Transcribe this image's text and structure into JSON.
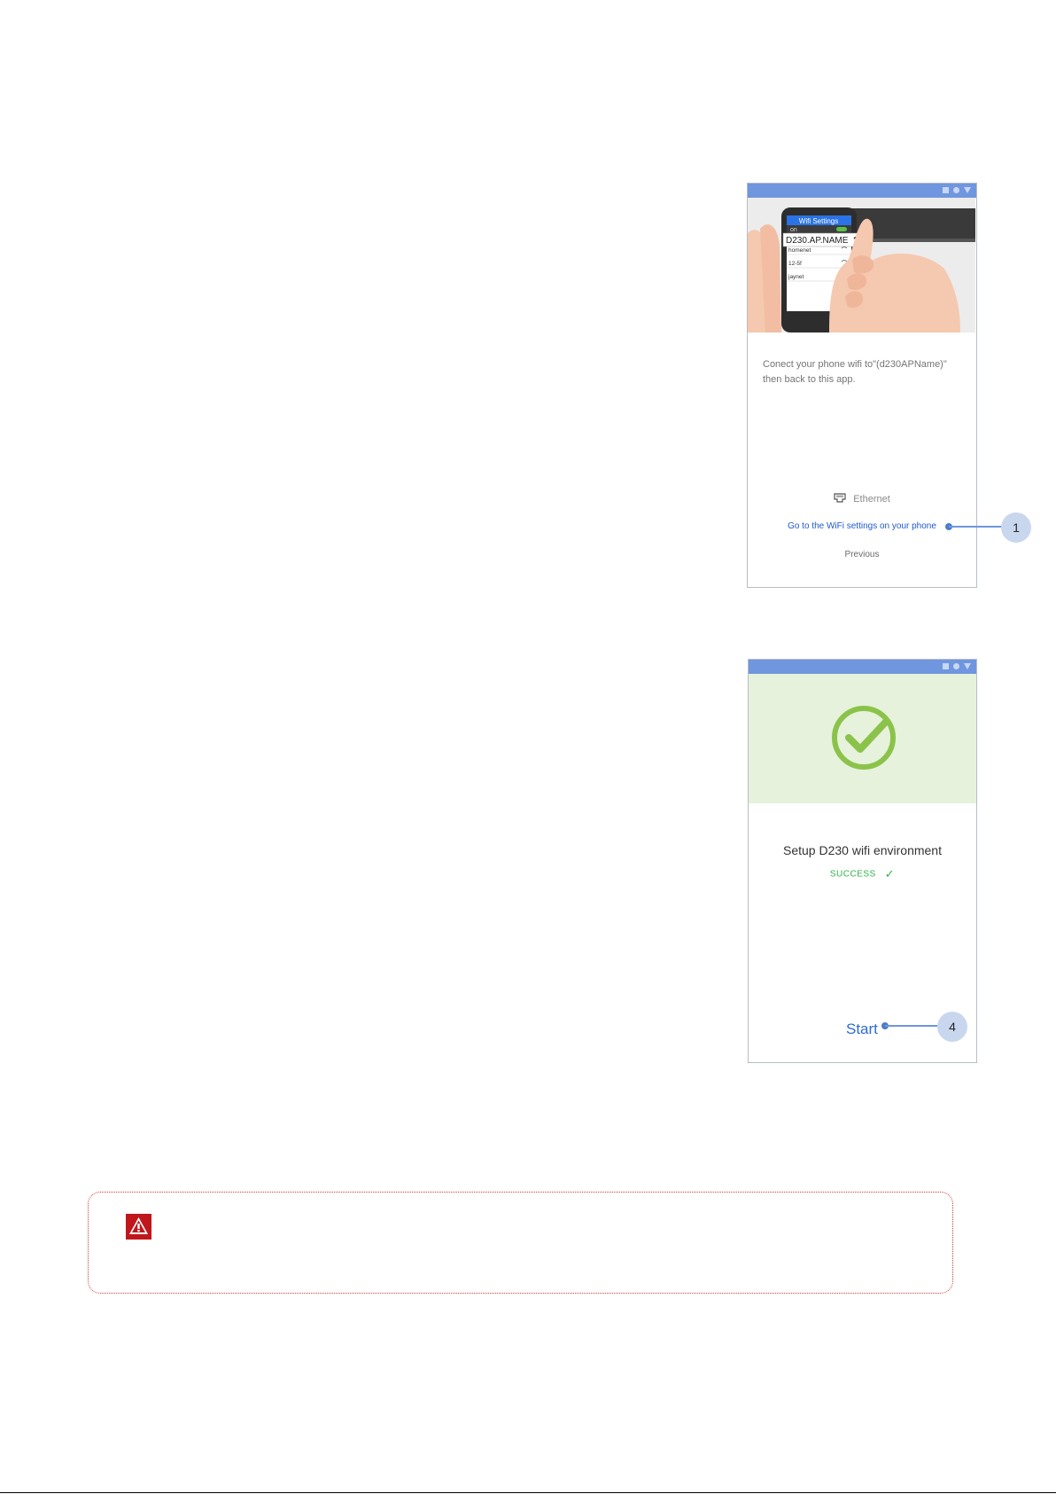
{
  "phone1": {
    "illustration": {
      "wifi_settings_label": "Wifi Settings",
      "on_label": "on",
      "selected_network": "D230.AP.NAME",
      "networks": [
        "homenet",
        "12-5f",
        "jaynet"
      ]
    },
    "instruction_text": "Conect your phone wifi to\"(d230APName)\" then back to this app.",
    "ethernet_label": "Ethernet",
    "goto_wifi_link": "Go to the WiFi settings on your phone",
    "previous_label": "Previous",
    "callout_number": "1"
  },
  "phone2": {
    "setup_title": "Setup D230 wifi environment",
    "success_label": "SUCCESS",
    "success_tick": "✓",
    "start_label": "Start",
    "callout_number": "4"
  },
  "colors": {
    "status_bar": "#6f96de",
    "link_blue": "#1f5ad1",
    "success_green": "#2fb34a",
    "check_green": "#8bc34a",
    "warning_red": "#c0171c",
    "callout_bubble": "#c9d7ee"
  },
  "icons": {
    "warning": "warning-triangle-icon",
    "ethernet": "ethernet-port-icon",
    "check": "check-circle-icon",
    "wifi": "wifi-icon"
  }
}
